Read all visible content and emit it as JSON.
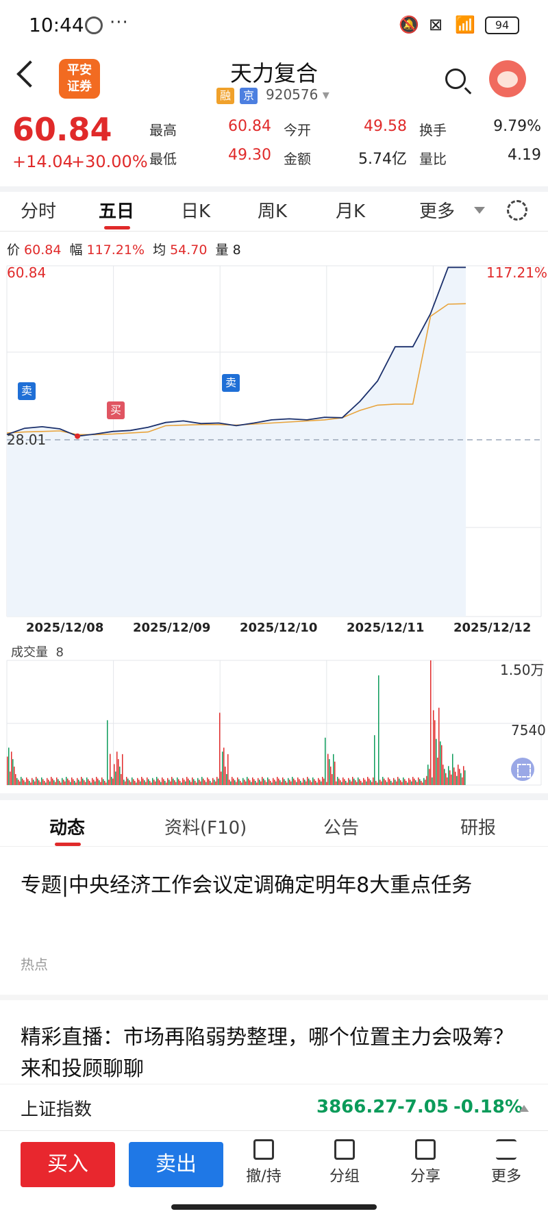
{
  "status": {
    "time": "10:44",
    "dots": "···",
    "battery": "94"
  },
  "header": {
    "logo_line1": "平安",
    "logo_line2": "证券",
    "title": "天力复合",
    "tag_rong": "融",
    "tag_jing": "京",
    "code": "920576"
  },
  "quote": {
    "price": "60.84",
    "change": "+14.04",
    "change_pct": "+30.00%",
    "high_label": "最高",
    "high": "60.84",
    "low_label": "最低",
    "low": "49.30",
    "open_label": "今开",
    "open": "49.58",
    "amount_label": "金额",
    "amount": "5.74亿",
    "turnover_label": "换手",
    "turnover": "9.79%",
    "ratio_label": "量比",
    "ratio": "4.19"
  },
  "tabs": [
    {
      "label": "分时"
    },
    {
      "label": "五日"
    },
    {
      "label": "日K"
    },
    {
      "label": "周K"
    },
    {
      "label": "月K"
    },
    {
      "label": "更多"
    }
  ],
  "info": {
    "price_label": "价",
    "price": "60.84",
    "amp_label": "幅",
    "amp": "117.21%",
    "avg_label": "均",
    "avg": "54.70",
    "vol_label": "量",
    "vol": "8"
  },
  "chart_labels": {
    "top_price": "60.84",
    "top_pct": "117.21%",
    "ref_price": "28.01"
  },
  "markers": {
    "sell": "卖",
    "buy": "买"
  },
  "dates": [
    "2025/12/08",
    "2025/12/09",
    "2025/12/10",
    "2025/12/11",
    "2025/12/12"
  ],
  "volume": {
    "label": "成交量",
    "value": "8",
    "ymax": "1.50万",
    "ymid": "7540"
  },
  "colors": {
    "up": "#e02a2a",
    "down": "#0b9b5a",
    "price_line": "#1a2f6b",
    "avg_line": "#e8a33a",
    "buy": "#1aa34a",
    "sell_blue": "#1f6fd6"
  },
  "chart_data": {
    "type": "line",
    "title": "",
    "xlabel": "",
    "ylabel": "",
    "x": [
      "2025/12/08",
      "2025/12/09",
      "2025/12/10",
      "2025/12/11",
      "2025/12/12"
    ],
    "reference_close": 28.01,
    "ylim": [
      28.01,
      60.84
    ],
    "series": [
      {
        "values": [
          29.0,
          30.2,
          30.5,
          30.1,
          28.7,
          29.1,
          29.6,
          29.8,
          30.4,
          31.3,
          31.6,
          31.1,
          31.2,
          30.7,
          31.2,
          31.8,
          32.0,
          31.8,
          32.3,
          32.2,
          35.3,
          39.2,
          45.7,
          45.7,
          52.0,
          60.8,
          60.8
        ]
      },
      {
        "values": [
          29.3,
          29.5,
          29.6,
          29.7,
          29.0,
          29.0,
          29.1,
          29.3,
          29.5,
          30.7,
          30.8,
          30.9,
          30.9,
          30.8,
          31.0,
          31.2,
          31.4,
          31.6,
          31.8,
          32.2,
          33.6,
          34.6,
          34.8,
          34.8,
          51.5,
          53.8,
          53.9
        ]
      }
    ],
    "volume_ylim": [
      0,
      15000
    ],
    "volume_ticks": [
      "1.50万",
      "7540"
    ]
  },
  "subtabs": [
    {
      "label": "动态"
    },
    {
      "label": "资料(F10)"
    },
    {
      "label": "公告"
    },
    {
      "label": "研报"
    }
  ],
  "news": [
    {
      "title": "专题|中央经济工作会议定调确定明年8大重点任务",
      "tag": "热点"
    },
    {
      "title": "精彩直播：市场再陷弱势整理，哪个位置主力会吸筹？来和投顾聊聊"
    }
  ],
  "index": {
    "name": "上证指数",
    "value": "3866.27",
    "change": "-7.05",
    "change_pct": "-0.18%"
  },
  "toolbar": {
    "buy": "买入",
    "sell": "卖出",
    "withdraw": "撤/持",
    "group": "分组",
    "share": "分享",
    "more": "更多"
  }
}
